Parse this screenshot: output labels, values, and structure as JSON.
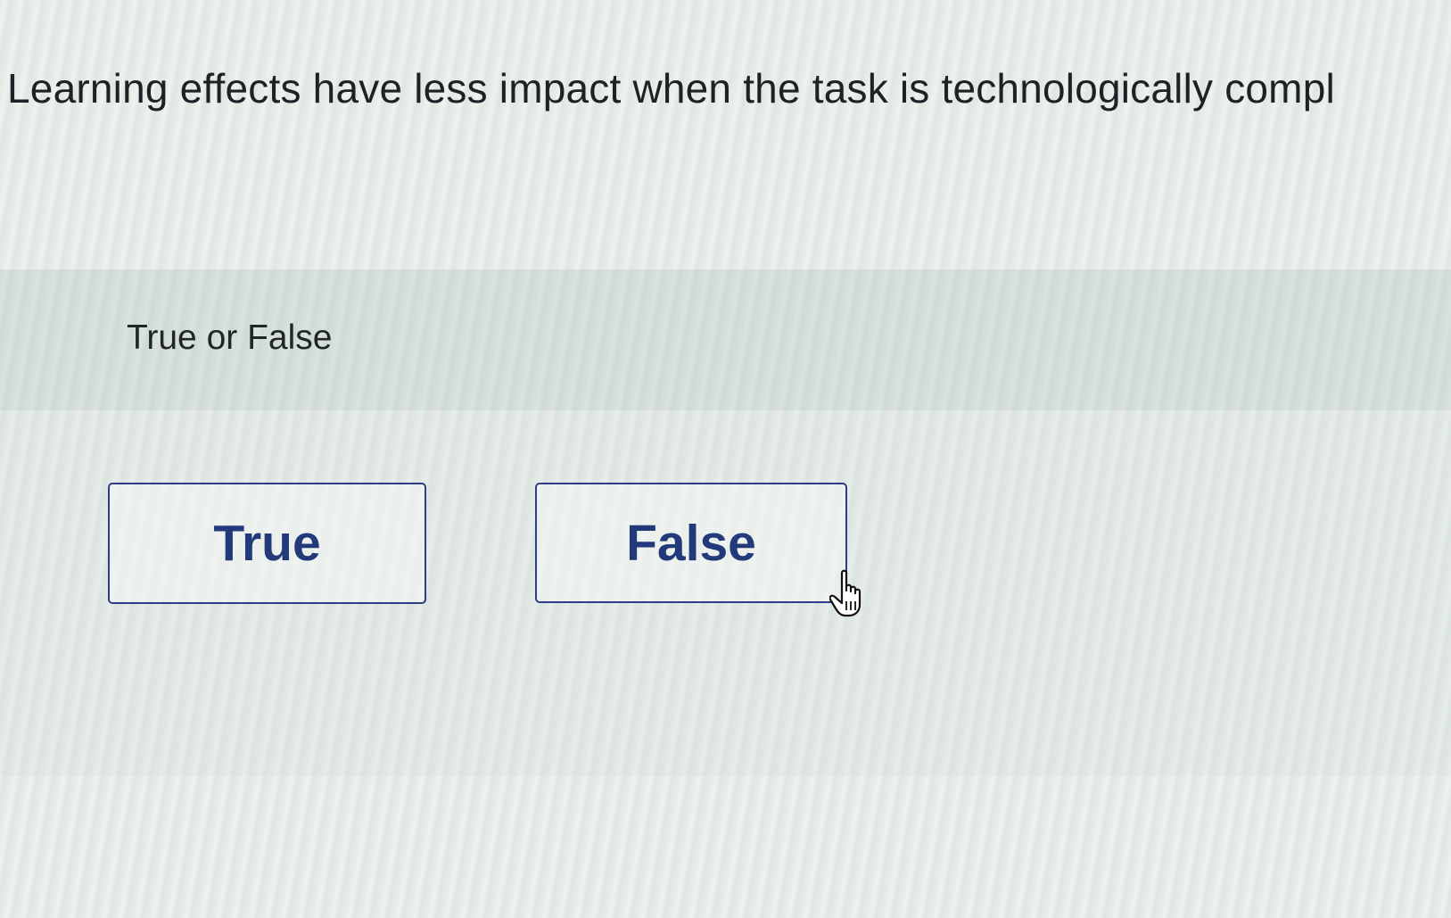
{
  "question": {
    "text": "Learning effects have less impact when the task is technologically compl"
  },
  "prompt": {
    "label": "True or False"
  },
  "choices": [
    {
      "label": "True"
    },
    {
      "label": "False"
    }
  ],
  "colors": {
    "accent": "#2f3d86",
    "choice_text": "#233a7a",
    "body_text": "#1d2226"
  },
  "cursor": {
    "icon": "hand-pointer-icon"
  }
}
